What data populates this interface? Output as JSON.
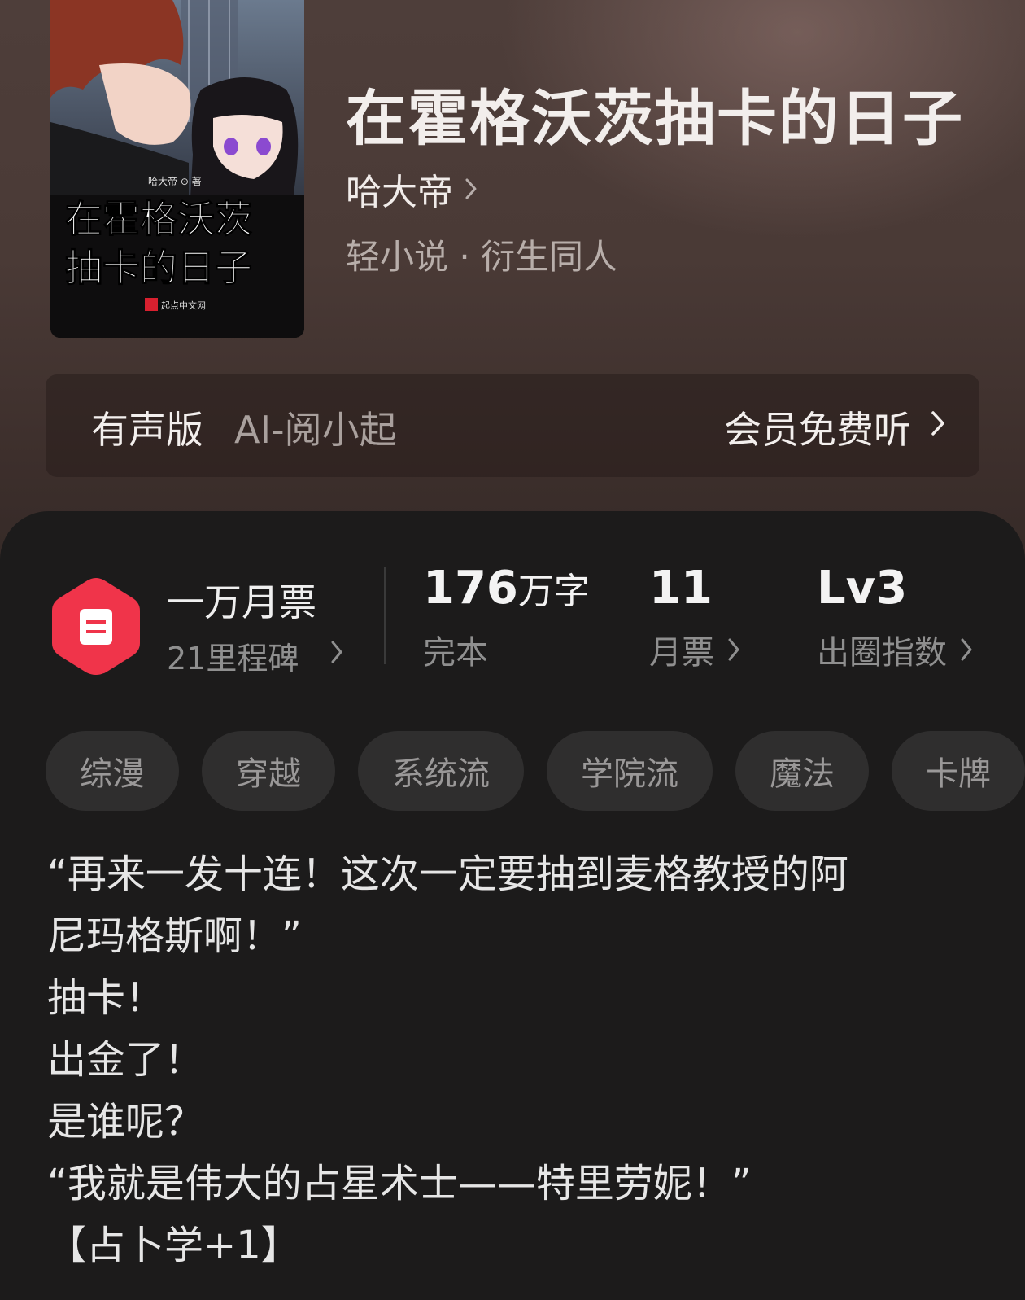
{
  "book": {
    "title": "在霍格沃茨抽卡的日子",
    "author": "哈大帝",
    "genre": "轻小说 · 衍生同人",
    "cover": {
      "title_line1": "在霍格沃茨",
      "title_line2": "抽卡的日子",
      "author_credit": "哈大帝 ⊙ 著",
      "publisher": "起点中文网"
    }
  },
  "audio": {
    "label": "有声版",
    "narrator": "AI-阅小起",
    "cta": "会员免费听"
  },
  "stats": {
    "monthly_title": "一万月票",
    "milestone": "21里程碑",
    "word_count_value": "176",
    "word_count_unit": "万字",
    "status": "完本",
    "monthly_votes_value": "11",
    "monthly_votes_label": "月票",
    "level_value": "Lv3",
    "level_label": "出圈指数"
  },
  "tags": [
    "综漫",
    "穿越",
    "系统流",
    "学院流",
    "魔法",
    "卡牌"
  ],
  "synopsis": [
    "“再来一发十连！这次一定要抽到麦格教授的阿",
    "尼玛格斯啊！”",
    "抽卡！",
    "出金了！",
    "是谁呢？",
    "“我就是伟大的占星术士——特里劳妮！”",
    "【占卜学+1】"
  ],
  "colors": {
    "hero_bg": "#4a3a36",
    "sheet_bg": "#1c1b1b",
    "tag_bg": "#2f2e2e",
    "ticket_red": "#f0344a"
  },
  "icons": {
    "ticket": "monthly-ticket-icon",
    "chevron": "chevron-right-icon"
  }
}
